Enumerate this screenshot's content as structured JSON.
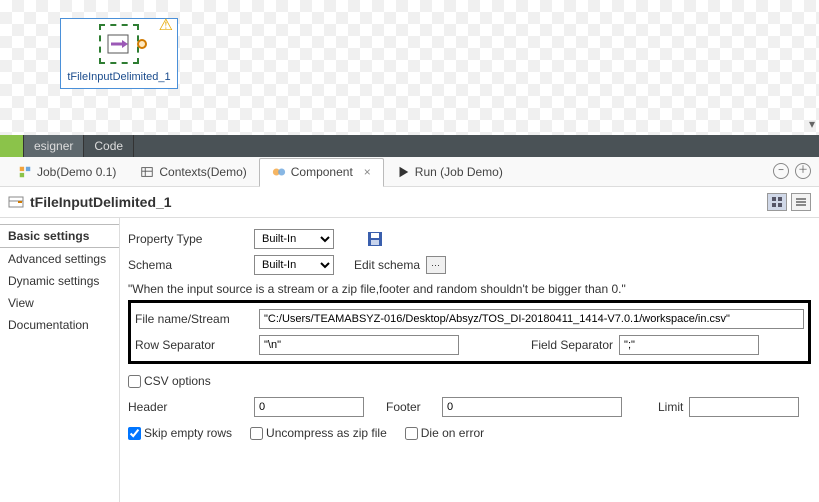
{
  "canvas": {
    "component_label": "tFileInputDelimited_1"
  },
  "editor_tabs": {
    "designer": "esigner",
    "code": "Code"
  },
  "view_tabs": {
    "job": "Job(Demo 0.1)",
    "contexts": "Contexts(Demo)",
    "component": "Component",
    "run": "Run (Job Demo)"
  },
  "title": "tFileInputDelimited_1",
  "side_nav": {
    "basic": "Basic settings",
    "advanced": "Advanced settings",
    "dynamic": "Dynamic settings",
    "view": "View",
    "documentation": "Documentation"
  },
  "form": {
    "property_type_label": "Property Type",
    "property_type_value": "Built-In",
    "schema_label": "Schema",
    "schema_value": "Built-In",
    "edit_schema": "Edit schema",
    "note": "\"When the input source is a stream or a zip file,footer and random shouldn't be bigger than 0.\"",
    "filename_label": "File name/Stream",
    "filename_value": "\"C:/Users/TEAMABSYZ-016/Desktop/Absyz/TOS_DI-20180411_1414-V7.0.1/workspace/in.csv\"",
    "row_sep_label": "Row Separator",
    "row_sep_value": "\"\\n\"",
    "field_sep_label": "Field Separator",
    "field_sep_value": "\";\"",
    "csv_options": "CSV options",
    "header_label": "Header",
    "header_value": "0",
    "footer_label": "Footer",
    "footer_value": "0",
    "limit_label": "Limit",
    "limit_value": "",
    "skip_empty": "Skip empty rows",
    "uncompress": "Uncompress as zip file",
    "die_on_error": "Die on error"
  }
}
